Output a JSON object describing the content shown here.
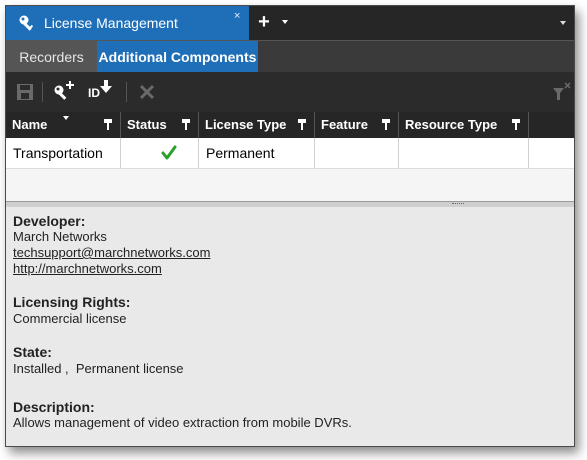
{
  "window": {
    "tab_title": "License Management",
    "tab_close": "×",
    "add_tab": "+"
  },
  "subtabs": [
    {
      "label": "Recorders",
      "active": false
    },
    {
      "label": "Additional Components",
      "active": true
    }
  ],
  "toolbar": {
    "id_label": "ID"
  },
  "grid": {
    "columns": [
      "Name",
      "Status",
      "License Type",
      "Feature",
      "Resource Type"
    ],
    "rows": [
      {
        "name": "Transportation",
        "status_icon": "check-icon",
        "license_type": "Permanent",
        "feature": "",
        "resource_type": ""
      }
    ]
  },
  "details": {
    "developer_heading": "Developer:",
    "developer_name": "March Networks",
    "developer_email": "techsupport@marchnetworks.com",
    "developer_url": "http://marchnetworks.com",
    "rights_heading": "Licensing Rights:",
    "rights_value": "Commercial license",
    "state_heading": "State:",
    "state_value": "Installed ,  Permanent license",
    "description_heading": "Description:",
    "description_value": "Allows management of video extraction from mobile DVRs."
  },
  "colors": {
    "accent": "#1e6fb8",
    "check": "#2aa02a",
    "dark": "#262626"
  }
}
